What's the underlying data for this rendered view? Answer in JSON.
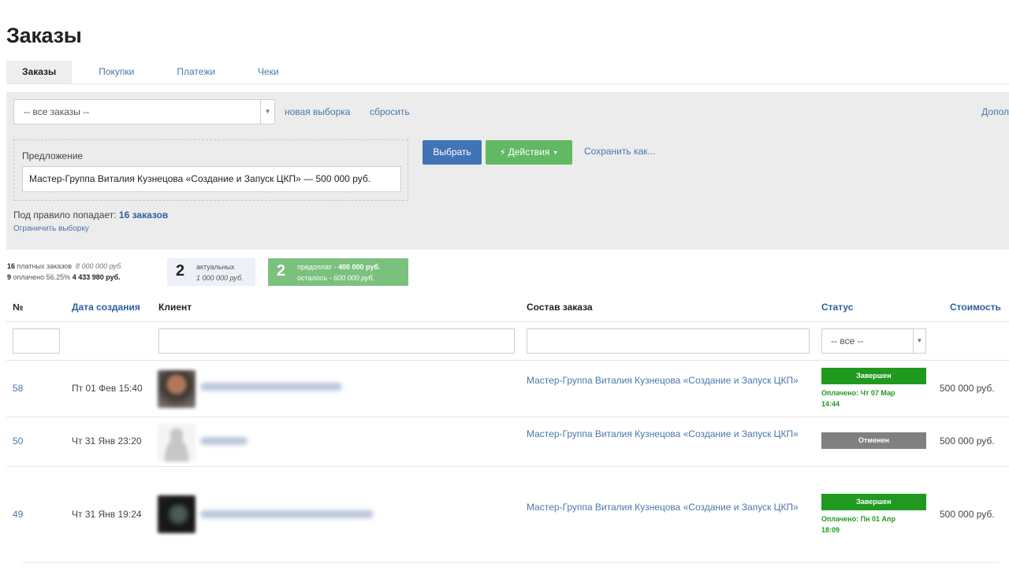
{
  "page": {
    "title": "Заказы"
  },
  "tabs": [
    "Заказы",
    "Покупки",
    "Платежи",
    "Чеки"
  ],
  "filter": {
    "preset": "-- все заказы --",
    "new_selection": "новая выборка",
    "reset": "сбросить",
    "more": "Допол",
    "rule_label": "Предложение",
    "rule_value": "Мастер-Группа Виталия Кузнецова «Создание и Запуск ЦКП» — 500 000 руб.",
    "select_button": "Выбрать",
    "actions_button": "Действия",
    "save_as": "Сохранить как...",
    "match_prefix": "Под правило попадает:",
    "match_count": "16 заказов",
    "limit": "Ограничить выборку"
  },
  "stats": {
    "paid_count": "16",
    "paid_label": "платных заказов",
    "paid_sum": "8 000 000 руб.",
    "paid_done_count": "9",
    "paid_done_label": "оплачено 56.25%",
    "paid_done_sum": "4 433 980 руб.",
    "actual_count": "2",
    "actual_label": "актуальных",
    "actual_sum": "1 000 000 руб.",
    "prepay_count": "2",
    "prepay_label": "предоплат -",
    "prepay_sum": "400 000 руб.",
    "remaining_label": "осталось -",
    "remaining_sum": "600 000 руб."
  },
  "table": {
    "columns": {
      "num": "№",
      "date": "Дата создания",
      "client": "Клиент",
      "items": "Состав заказа",
      "status": "Статус",
      "price": "Стоимость"
    },
    "status_filter": "-- все --",
    "rows": [
      {
        "num": "58",
        "date": "Пт 01 Фев 15:40",
        "items": "Мастер-Группа Виталия Кузнецова «Создание и Запуск ЦКП»",
        "status": "Завершен",
        "status_type": "done",
        "paid_line1": "Оплачено: Чт 07 Мар",
        "paid_line2": "14:44",
        "price": "500 000 руб."
      },
      {
        "num": "50",
        "date": "Чт 31 Янв 23:20",
        "items": "Мастер-Группа Виталия Кузнецова «Создание и Запуск ЦКП»",
        "status": "Отменен",
        "status_type": "cancel",
        "paid_line1": "",
        "paid_line2": "",
        "price": "500 000 руб."
      },
      {
        "num": "49",
        "date": "Чт 31 Янв 19:24",
        "items": "Мастер-Группа Виталия Кузнецова «Создание и Запуск ЦКП»",
        "status": "Завершен",
        "status_type": "done",
        "paid_line1": "Оплачено: Пн 01 Апр",
        "paid_line2": "18:09",
        "price": "500 000 руб."
      }
    ]
  },
  "icons": {
    "actions": "lightning-icon",
    "caret": "caret-down-icon",
    "select_arrow": "chevron-down-icon"
  },
  "colors": {
    "link": "#4a77ad",
    "primary": "#4174b6",
    "success": "#62b963",
    "done_badge": "#1f9a1f",
    "cancel_badge": "#808080",
    "panel": "#ececec"
  }
}
